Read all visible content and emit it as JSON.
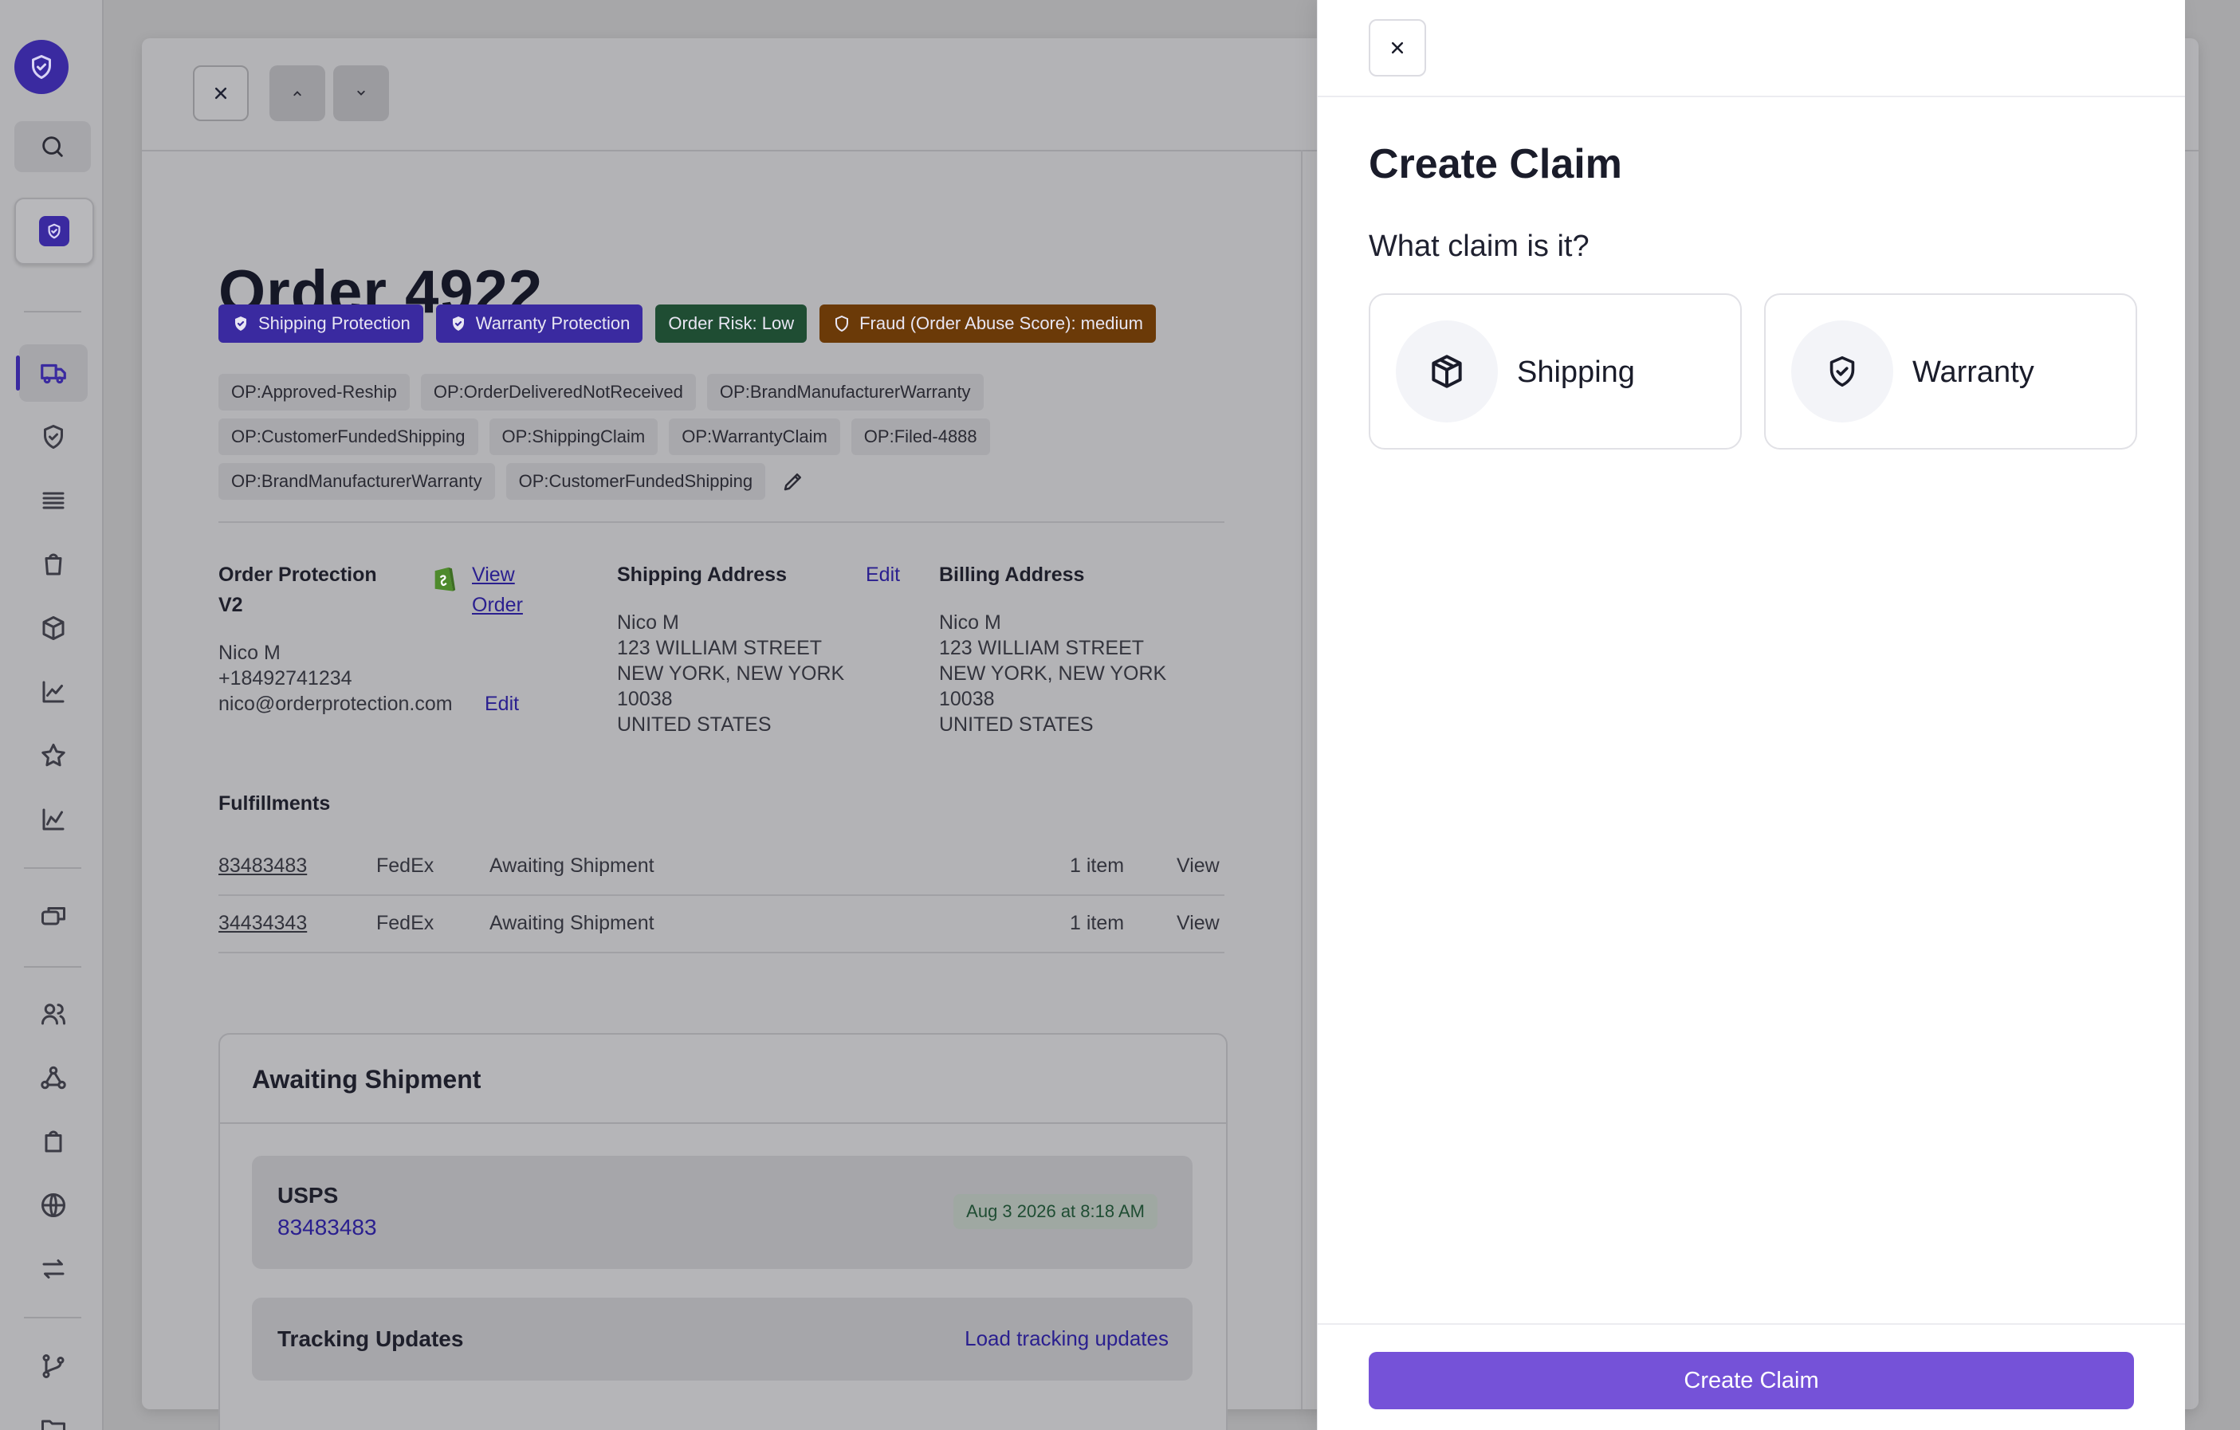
{
  "sidebar": {
    "items": [
      {
        "icon": "truck-icon",
        "active": true
      },
      {
        "icon": "shield-check-icon",
        "active": false
      },
      {
        "icon": "list-icon",
        "active": false
      },
      {
        "icon": "bag-icon",
        "active": false
      },
      {
        "icon": "box-icon",
        "active": false
      },
      {
        "icon": "chart-icon",
        "active": false
      },
      {
        "icon": "star-icon",
        "active": false
      },
      {
        "icon": "chart-alt-icon",
        "active": false
      },
      {
        "icon": "messages-icon",
        "active": false
      },
      {
        "icon": "users-icon",
        "active": false
      },
      {
        "icon": "webhook-icon",
        "active": false
      },
      {
        "icon": "bag-alt-icon",
        "active": false
      },
      {
        "icon": "globe-icon",
        "active": false
      },
      {
        "icon": "arrows-icon",
        "active": false
      },
      {
        "icon": "branch-icon",
        "active": false
      },
      {
        "icon": "folder-icon",
        "active": false
      }
    ]
  },
  "order": {
    "title": "Order 4922",
    "badges": {
      "shipping": "Shipping Protection",
      "warranty": "Warranty Protection",
      "risk": "Order Risk: Low",
      "fraud": "Fraud (Order Abuse Score): medium"
    },
    "tags": [
      [
        "OP:Approved-Reship",
        "OP:OrderDeliveredNotReceived",
        "OP:BrandManufacturerWarranty"
      ],
      [
        "OP:CustomerFundedShipping",
        "OP:ShippingClaim",
        "OP:WarrantyClaim",
        "OP:Filed-4888"
      ],
      [
        "OP:BrandManufacturerWarranty",
        "OP:CustomerFundedShipping"
      ]
    ],
    "store_line1": "Order Protection",
    "store_line2": "V2",
    "view_order_line1": "View",
    "view_order_line2": "Order",
    "customer": {
      "name": "Nico M",
      "phone": "+18492741234",
      "email": "nico@orderprotection.com",
      "edit": "Edit"
    },
    "shipping_address": {
      "heading": "Shipping Address",
      "edit": "Edit",
      "lines": [
        "Nico M",
        "123 WILLIAM STREET",
        "NEW YORK, NEW YORK",
        "10038",
        "UNITED STATES"
      ]
    },
    "billing_address": {
      "heading": "Billing Address",
      "lines": [
        "Nico M",
        "123 WILLIAM STREET",
        "NEW YORK, NEW YORK",
        "10038",
        "UNITED STATES"
      ]
    },
    "fulfillments": {
      "heading": "Fulfillments",
      "rows": [
        {
          "id": "83483483",
          "carrier": "FedEx",
          "status": "Awaiting Shipment",
          "items": "1 item",
          "action": "View"
        },
        {
          "id": "34434343",
          "carrier": "FedEx",
          "status": "Awaiting Shipment",
          "items": "1 item",
          "action": "View"
        }
      ]
    },
    "shipment_card": {
      "title": "Awaiting Shipment",
      "carrier": "USPS",
      "tracking": "83483483",
      "date": "Aug 3 2026 at 8:18 AM",
      "tracking_updates": "Tracking Updates",
      "load_updates": "Load tracking updates"
    }
  },
  "drawer": {
    "title": "Create Claim",
    "question": "What claim is it?",
    "options": [
      {
        "label": "Shipping",
        "icon": "package-icon"
      },
      {
        "label": "Warranty",
        "icon": "shield-check-icon"
      }
    ],
    "submit": "Create Claim"
  },
  "colors": {
    "brand": "#3a2aa0",
    "primary_button": "#7552d8",
    "risk_green": "#1f4d33",
    "fraud_brown": "#6b3a08"
  }
}
